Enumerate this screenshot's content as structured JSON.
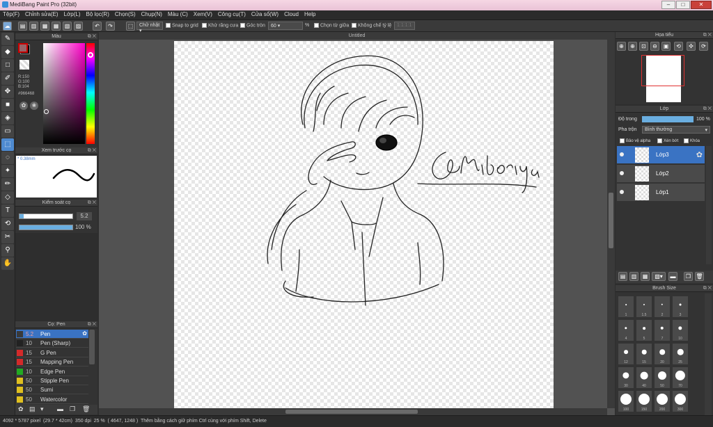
{
  "window": {
    "title": "MediBang Paint Pro (32bit)"
  },
  "menu": [
    "Tệp(F)",
    "Chỉnh sửa(E)",
    "Lớp(L)",
    "Bộ lọc(R)",
    "Chọn(S)",
    "Chụp(N)",
    "Màu (C)",
    "Xem(V)",
    "Công cụ(T)",
    "Cửa sổ(W)",
    "Cloud",
    "Help"
  ],
  "toolbar": {
    "selection_mode": "Chữ nhật",
    "snap_grid": "Snap to grid",
    "antialias": "Khử răng cưa",
    "corner": "Góc tròn",
    "corner_value": "60",
    "corner_unit": "%",
    "select_from_center": "Chọn từ giữa",
    "fixed_ratio": "Không chế tỷ lệ",
    "ratio_value": "1:1:1:1"
  },
  "color_panel": {
    "title": "Màu",
    "r": "R:150",
    "g": "G:100",
    "b": "B:104",
    "hex": "#966468",
    "primary_color": "#966468"
  },
  "preview_panel": {
    "title": "Xem trước cọ",
    "size": "* 0.38mm"
  },
  "correction_panel": {
    "title": "Kiểm soát cọ",
    "value": "5.2",
    "opacity": "100 %"
  },
  "brush_panel": {
    "title": "Cọ: Pen",
    "items": [
      {
        "size": "5.2",
        "name": "Pen",
        "color": "#3a3a3a",
        "selected": true
      },
      {
        "size": "10",
        "name": "Pen (Sharp)",
        "color": "#222222"
      },
      {
        "size": "15",
        "name": "G Pen",
        "color": "#d42a2a"
      },
      {
        "size": "15",
        "name": "Mapping Pen",
        "color": "#d42a2a"
      },
      {
        "size": "10",
        "name": "Edge Pen",
        "color": "#22aa22"
      },
      {
        "size": "50",
        "name": "Stipple Pen",
        "color": "#e0c020"
      },
      {
        "size": "50",
        "name": "Sumi",
        "color": "#e0c020"
      },
      {
        "size": "50",
        "name": "Watercolor",
        "color": "#e0c020"
      }
    ]
  },
  "canvas": {
    "tab": "Untitled",
    "signature": "@Midoriya"
  },
  "navigator": {
    "title": "Họa tiểu"
  },
  "layer_panel": {
    "title": "Lớp",
    "opacity_label": "Độ trong",
    "opacity_value": "100 %",
    "blend_label": "Pha trộn",
    "blend_value": "Bình thường",
    "protect_alpha": "Bảo vệ alpha",
    "clip": "Xén bớt",
    "lock": "Khóa",
    "layers": [
      {
        "name": "Lớp3",
        "selected": true
      },
      {
        "name": "Lớp2"
      },
      {
        "name": "Lớp1"
      }
    ]
  },
  "brush_size_panel": {
    "title": "Brush Size",
    "sizes": [
      "1",
      "1.5",
      "2",
      "3",
      "4",
      "5",
      "7",
      "10",
      "12",
      "15",
      "20",
      "25",
      "30",
      "40",
      "50",
      "70",
      "100",
      "150",
      "200",
      "300"
    ]
  },
  "status": {
    "dimensions": "4092 * 5787 pixel",
    "paper": "(29.7 * 42cm)",
    "dpi": "350 dpi",
    "zoom": "25 %",
    "coords": "( 4647, 1248 )",
    "hint": "Thêm bằng cách giữ phím Ctrl cùng với phím Shift, Delete"
  }
}
